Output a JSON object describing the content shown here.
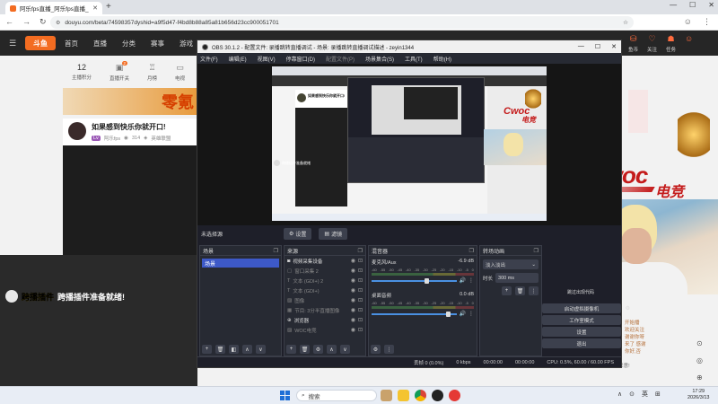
{
  "browser": {
    "tab_title": "阿乐fps直播_阿乐fps直播_阿乐",
    "url": "douyu.com/beta/74598357dyshid=a9f5d47-f4bd8b88a85a81b656d23cc900051701",
    "win_min": "—",
    "win_max": "☐",
    "win_close": "✕",
    "tab_close": "✕",
    "new_tab": "+"
  },
  "douyu": {
    "logo": "斗鱼",
    "nav": [
      "首页",
      "直播",
      "分类",
      "赛事",
      "游戏"
    ],
    "right_items": [
      {
        "icon": "⛁",
        "label": "鱼币"
      },
      {
        "icon": "♡",
        "label": "关注"
      },
      {
        "icon": "☗",
        "label": "任务"
      },
      {
        "icon": "☺",
        "label": ""
      }
    ],
    "stats": [
      {
        "num": "12",
        "label": "主播积分"
      },
      {
        "num": "",
        "label": "直播开关"
      },
      {
        "num": "",
        "label": "月榜"
      },
      {
        "num": "",
        "label": "电视"
      }
    ],
    "stat_badge": "2",
    "banner_text": "零氪",
    "room_title": "如果感到快乐你就开口!",
    "room_badge": "Lv",
    "room_meta_name": "阿乐fps",
    "room_meta_count": "314",
    "room_meta_extra": "英雄联盟",
    "overlay_title_yellow": "跨播插件",
    "overlay_title_white": "跨播插件准备就绪!",
    "chat_lines": [
      "开始播",
      "欢迎关注",
      "谢谢你呀",
      "来了 感谢",
      "你好,否"
    ],
    "bottom_msg": "欢迎: 喝上一杯奶茶 3 下载: 老板直播 2022520注明来意!",
    "side_icons": [
      "⊙",
      "◎",
      "⊕"
    ]
  },
  "woc": {
    "logo_text": "Cwoc",
    "logo_sub": "电竞"
  },
  "obs": {
    "title": "OBS 30.1.2 - 配置文件: 录播跳转直播调试 - 场景: 录播跳转直播调试描述 - zeyin1344",
    "menu": [
      "文件(F)",
      "编辑(E)",
      "视图(V)",
      "停靠窗口(D)",
      "配置文件(P)",
      "场景集合(S)",
      "工具(T)",
      "帮助(H)"
    ],
    "no_source": "未选择源",
    "btn_properties": "设置",
    "btn_filters": "滤镜",
    "docks": {
      "scenes_title": "场景",
      "sources_title": "来源",
      "mixer_title": "混音器",
      "transitions_title": "转场动画"
    },
    "scenes": [
      "场景"
    ],
    "sources": [
      {
        "name": "视频采集设备",
        "dim": false
      },
      {
        "name": "窗口采集 2",
        "dim": true
      },
      {
        "name": "文本 (GDI+) 2",
        "dim": true
      },
      {
        "name": "文本 (GDI+)",
        "dim": true
      },
      {
        "name": "图像",
        "dim": true
      },
      {
        "name": "节目: 3分半直播图像",
        "dim": true
      },
      {
        "name": "浏览器",
        "dim": false
      },
      {
        "name": "WOC电竞",
        "dim": true
      }
    ],
    "mixer": [
      {
        "name": "麦克风/Aux",
        "db": "-6.9 dB",
        "level": 0.65
      },
      {
        "name": "桌面音频",
        "db": "0.0 dB",
        "level": 0.9
      }
    ],
    "mixer_scale": [
      "-60",
      "-55",
      "-50",
      "-45",
      "-40",
      "-35",
      "-30",
      "-25",
      "-20",
      "-15",
      "-10",
      "-5",
      "0"
    ],
    "transition": "淡入淡出",
    "duration_label": "时长",
    "duration_value": "300 ms",
    "controls": [
      "启动虚拟摄像机",
      "工作室模式",
      "设置",
      "退出"
    ],
    "controls_top": "跳过出现代码",
    "status": {
      "frames": "丢帧 0 (0.0%)",
      "kbps": "0 kbps",
      "rec_time": "00:00:00",
      "live_time": "00:00:00",
      "cpu": "CPU: 0.5%, 60.00 / 60.00 FPS"
    },
    "nested_room": "如果感到快乐你就开口!",
    "nested_cap": "跨播插件准备就绪"
  },
  "taskbar": {
    "search_placeholder": "搜索",
    "tray": [
      "∧",
      "⊙",
      "英",
      "⊞"
    ],
    "time": "17:29",
    "date": "2026/3/13"
  },
  "colors": {
    "douyu_orange": "#f36c21",
    "obs_blue": "#3d59c8",
    "woc_red": "#c41b1b"
  }
}
